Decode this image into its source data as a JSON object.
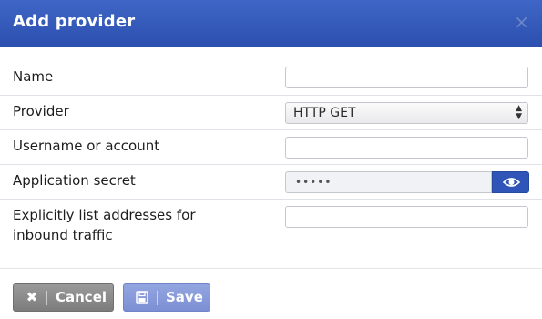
{
  "dialog": {
    "title": "Add provider",
    "close_glyph": "×"
  },
  "form": {
    "name_label": "Name",
    "name_value": "",
    "provider_label": "Provider",
    "provider_value": "HTTP GET",
    "username_label": "Username or account",
    "username_value": "",
    "secret_label": "Application secret",
    "secret_value": "•••••",
    "addresses_label": "Explicitly list addresses for inbound traffic",
    "addresses_value": ""
  },
  "buttons": {
    "cancel_label": "Cancel",
    "save_label": "Save"
  },
  "icons": {
    "close": "close-icon",
    "select_arrows": "select-arrows-icon",
    "eye": "eye-icon",
    "cancel": "x-icon",
    "save": "floppy-disk-icon"
  },
  "colors": {
    "header": "#2f55b8",
    "eye_button": "#2f55b8",
    "cancel_button": "#8a8a8a",
    "save_button": "#8799d9"
  }
}
